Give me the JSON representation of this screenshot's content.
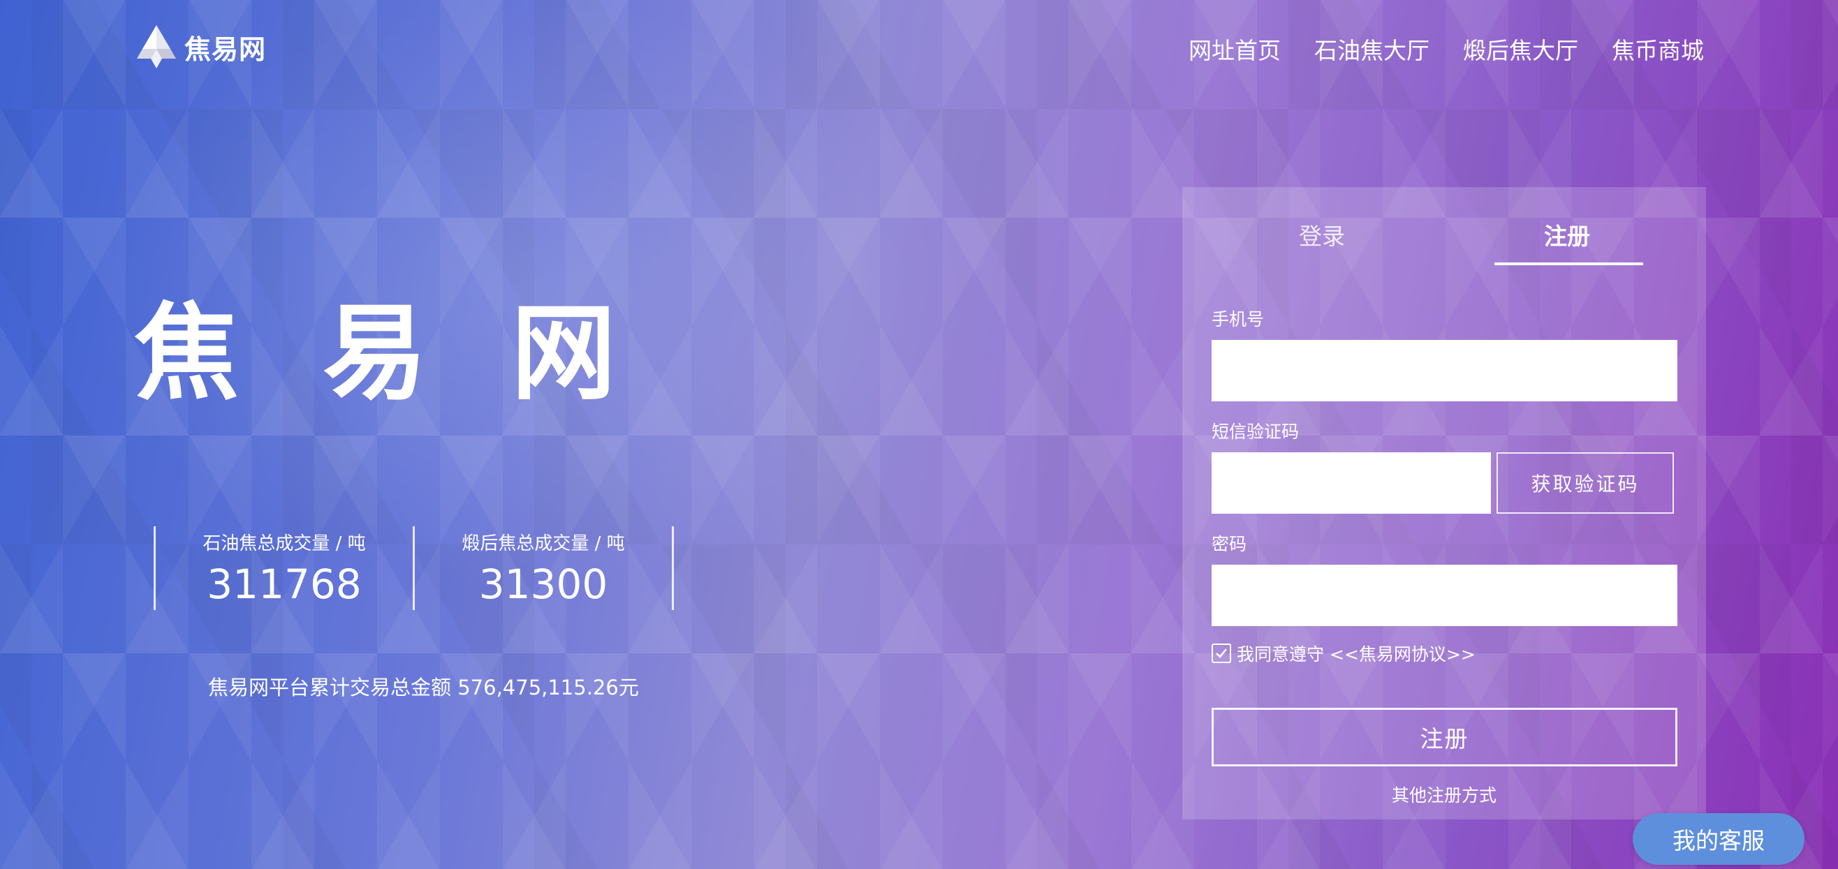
{
  "header": {
    "logo_text": "焦易网",
    "logo_icon": "diamond-logo-icon",
    "nav": [
      {
        "label": "网址首页"
      },
      {
        "label": "石油焦大厅"
      },
      {
        "label": "煅后焦大厅"
      },
      {
        "label": "焦币商城"
      }
    ]
  },
  "hero": {
    "title": "焦易网",
    "stats": [
      {
        "label": "石油焦总成交量 / 吨",
        "value": "311768"
      },
      {
        "label": "煅后焦总成交量 / 吨",
        "value": "31300"
      }
    ],
    "total_amount": "焦易网平台累计交易总金额 576,475,115.26元"
  },
  "form": {
    "tabs": [
      {
        "label": "登录",
        "active": false
      },
      {
        "label": "注册",
        "active": true
      }
    ],
    "phone_label": "手机号",
    "phone_value": "",
    "sms_label": "短信验证码",
    "sms_value": "",
    "sms_button": "获取验证码",
    "password_label": "密码",
    "password_value": "",
    "agree_checked": true,
    "agree_text": "我同意遵守",
    "agree_link": "<<焦易网协议>>",
    "submit_label": "注册",
    "other_label": "其他注册方式"
  },
  "service": {
    "label": "我的客服"
  },
  "colors": {
    "gradient_start": "#3f62d2",
    "gradient_end": "#8a2fb5",
    "service_button": "#5e8fdc"
  }
}
